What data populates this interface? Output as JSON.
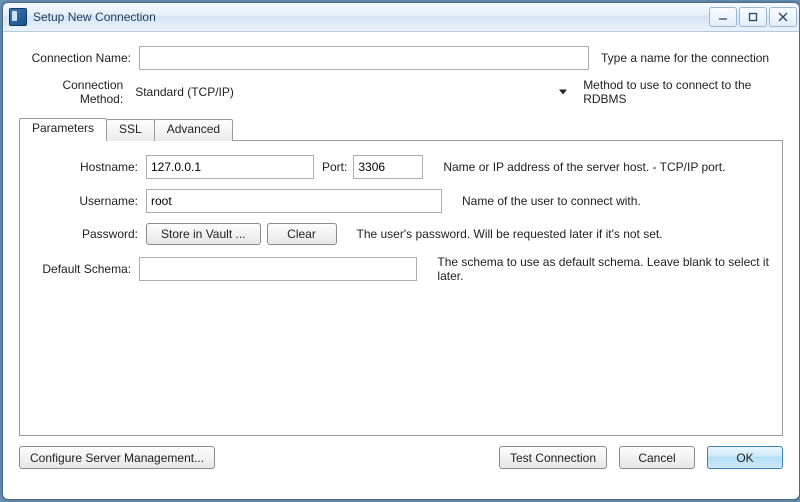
{
  "window": {
    "title": "Setup New Connection"
  },
  "form": {
    "name_label": "Connection Name:",
    "name_value": "",
    "name_hint": "Type a name for the connection",
    "method_label": "Connection Method:",
    "method_value": "Standard (TCP/IP)",
    "method_hint": "Method to use to connect to the RDBMS"
  },
  "tabs": {
    "parameters": "Parameters",
    "ssl": "SSL",
    "advanced": "Advanced"
  },
  "params": {
    "hostname_label": "Hostname:",
    "hostname_value": "127.0.0.1",
    "port_label": "Port:",
    "port_value": "3306",
    "hostname_hint": "Name or IP address of the server host. - TCP/IP port.",
    "username_label": "Username:",
    "username_value": "root",
    "username_hint": "Name of the user to connect with.",
    "password_label": "Password:",
    "store_btn": "Store in Vault ...",
    "clear_btn": "Clear",
    "password_hint": "The user's password. Will be requested later if it's not set.",
    "schema_label": "Default Schema:",
    "schema_value": "",
    "schema_hint": "The schema to use as default schema. Leave blank to select it later."
  },
  "footer": {
    "configure": "Configure Server Management...",
    "test": "Test Connection",
    "cancel": "Cancel",
    "ok": "OK"
  }
}
